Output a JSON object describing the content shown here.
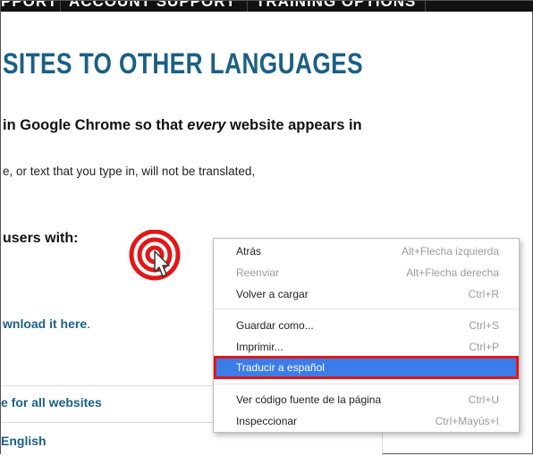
{
  "topbar": {
    "items": [
      "PPORT",
      "ACCOUNT SUPPORT",
      "TRAINING OPTIONS"
    ]
  },
  "page": {
    "heading": "SITES TO OTHER LANGUAGES",
    "lead_pre": "in Google Chrome so that ",
    "lead_em": "every",
    "lead_post": " website appears in",
    "note": "e, or text that you type in, will not be translated,",
    "users": "users with:",
    "download_link": "wnload it here",
    "download_tail": ".",
    "box_row1": "e for all websites",
    "box_row2": "English"
  },
  "context_menu": {
    "items": [
      {
        "label": "Atrás",
        "shortcut": "Alt+Flecha izquierda"
      },
      {
        "label": "Reenviar",
        "shortcut": "Alt+Flecha derecha"
      },
      {
        "label": "Volver a cargar",
        "shortcut": "Ctrl+R"
      },
      {
        "label": "Guardar como...",
        "shortcut": "Ctrl+S"
      },
      {
        "label": "Imprimir...",
        "shortcut": "Ctrl+P"
      },
      {
        "label": "Traducir a español",
        "shortcut": ""
      },
      {
        "label": "Ver código fuente de la página",
        "shortcut": "Ctrl+U"
      },
      {
        "label": "Inspeccionar",
        "shortcut": "Ctrl+Mayús+I"
      }
    ],
    "disabled_index": 1,
    "selected_index": 5
  },
  "colors": {
    "heading": "#1b5f86",
    "highlight": "#3b7de8",
    "highlight_border": "#e01818",
    "cursor_rings": "#e01818"
  }
}
